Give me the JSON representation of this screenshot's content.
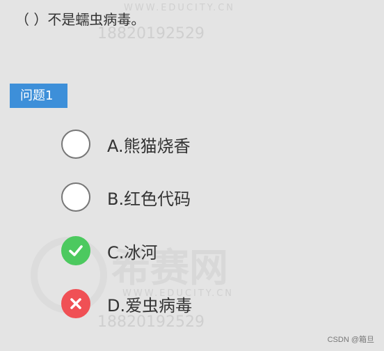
{
  "question": {
    "text": "（  ）不是蠕虫病毒。",
    "label": "问题1"
  },
  "options": [
    {
      "label": "A.熊猫烧香",
      "state": "unselected"
    },
    {
      "label": "B.红色代码",
      "state": "unselected"
    },
    {
      "label": "C.冰河",
      "state": "correct"
    },
    {
      "label": "D.爱虫病毒",
      "state": "wrong"
    }
  ],
  "watermark": {
    "site": "WWW.EDUCITY.CN",
    "phone": "18820192529",
    "brand": "希赛网"
  },
  "credit": "CSDN @箱旦",
  "colors": {
    "background": "#e4e4e4",
    "label_bg": "#3d8fd9",
    "correct": "#4cc95f",
    "wrong": "#f05055"
  }
}
